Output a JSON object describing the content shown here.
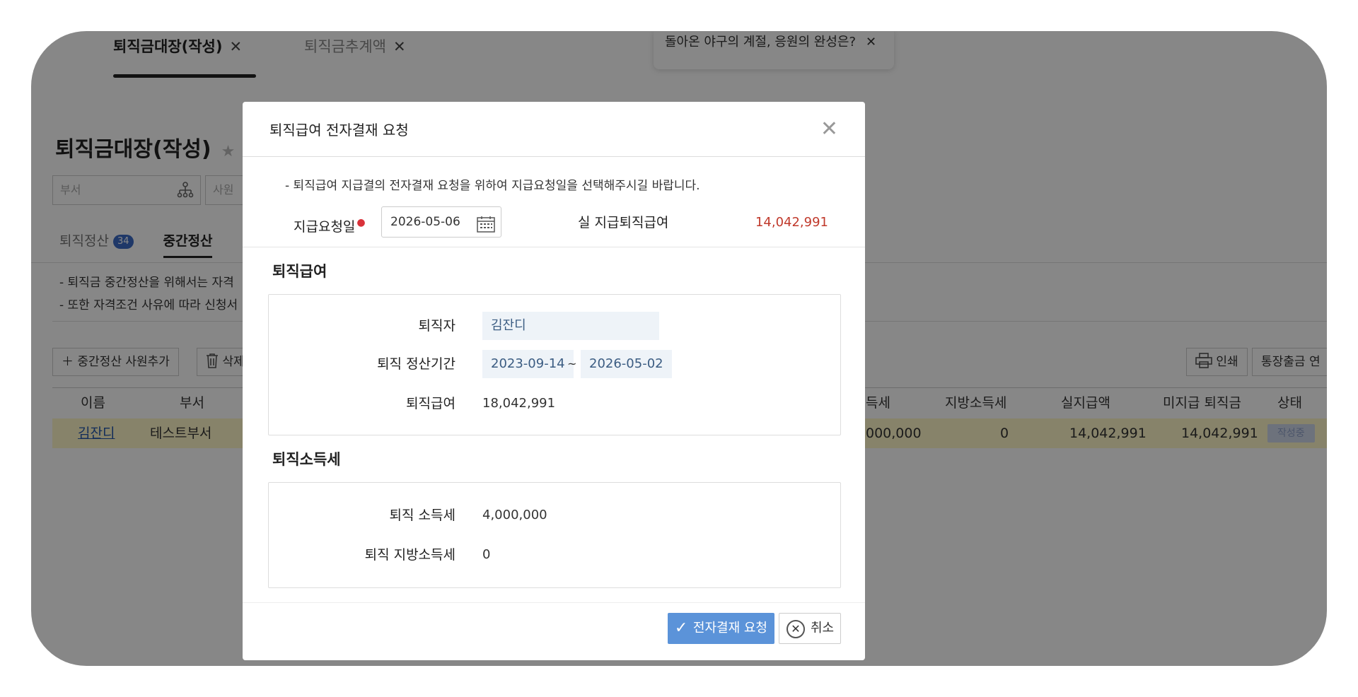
{
  "top_tabs": [
    {
      "label": "퇴직금대장(작성)",
      "close": "✕"
    },
    {
      "label": "퇴직금추계액",
      "close": "✕"
    }
  ],
  "toast": {
    "text": "돌아온 야구의 계절, 응원의 완성은?",
    "close": "✕"
  },
  "page": {
    "title": "퇴직금대장(작성)",
    "star": "★",
    "dept_placeholder": "부서",
    "emp_placeholder": "사원",
    "subtabs": [
      {
        "label": "퇴직정산",
        "badge": "34"
      },
      {
        "label": "중간정산"
      }
    ],
    "notes": [
      "- 퇴직금 중간정산을 위해서는 자격",
      "- 또한 자격조건 사유에 따라 신청서"
    ],
    "buttons": {
      "add": "중간정산 사원추가",
      "delete": "삭제",
      "print": "인쇄",
      "bank": "통장출금 연"
    },
    "table": {
      "headers": [
        "이름",
        "부서",
        "득세",
        "지방소득세",
        "실지급액",
        "미지급 퇴직금",
        "상태"
      ],
      "row": {
        "name": "김잔디",
        "dept": "테스트부서",
        "tax": "000,000",
        "local_tax": "0",
        "paid": "14,042,991",
        "unpaid": "14,042,991",
        "status": "작성중"
      }
    }
  },
  "modal": {
    "title": "퇴직급여 전자결재 요청",
    "note": "- 퇴직급여 지급결의 전자결재 요청을 위하여 지급요청일을 선택해주시길 바랍니다.",
    "request_date_label": "지급요청일",
    "required_mark": "●",
    "request_date": "2026-05-06",
    "actual_label": "실 지급퇴직급여",
    "actual_value": "14,042,991",
    "pay_section": {
      "title": "퇴직급여",
      "retiree_label": "퇴직자",
      "retiree": "김잔디",
      "period_label": "퇴직 정산기간",
      "period_start": "2023-09-14",
      "period_sep": "~",
      "period_end": "2026-05-02",
      "pay_label": "퇴직급여",
      "pay_value": "18,042,991"
    },
    "tax_section": {
      "title": "퇴직소득세",
      "income_tax_label": "퇴직 소득세",
      "income_tax": "4,000,000",
      "local_tax_label": "퇴직 지방소득세",
      "local_tax": "0"
    },
    "submit_label": "전자결재 요청",
    "cancel_label": "취소"
  },
  "colors": {
    "accent": "#5b93d9",
    "amount_red": "#c0392b",
    "overlay": "#000000"
  }
}
